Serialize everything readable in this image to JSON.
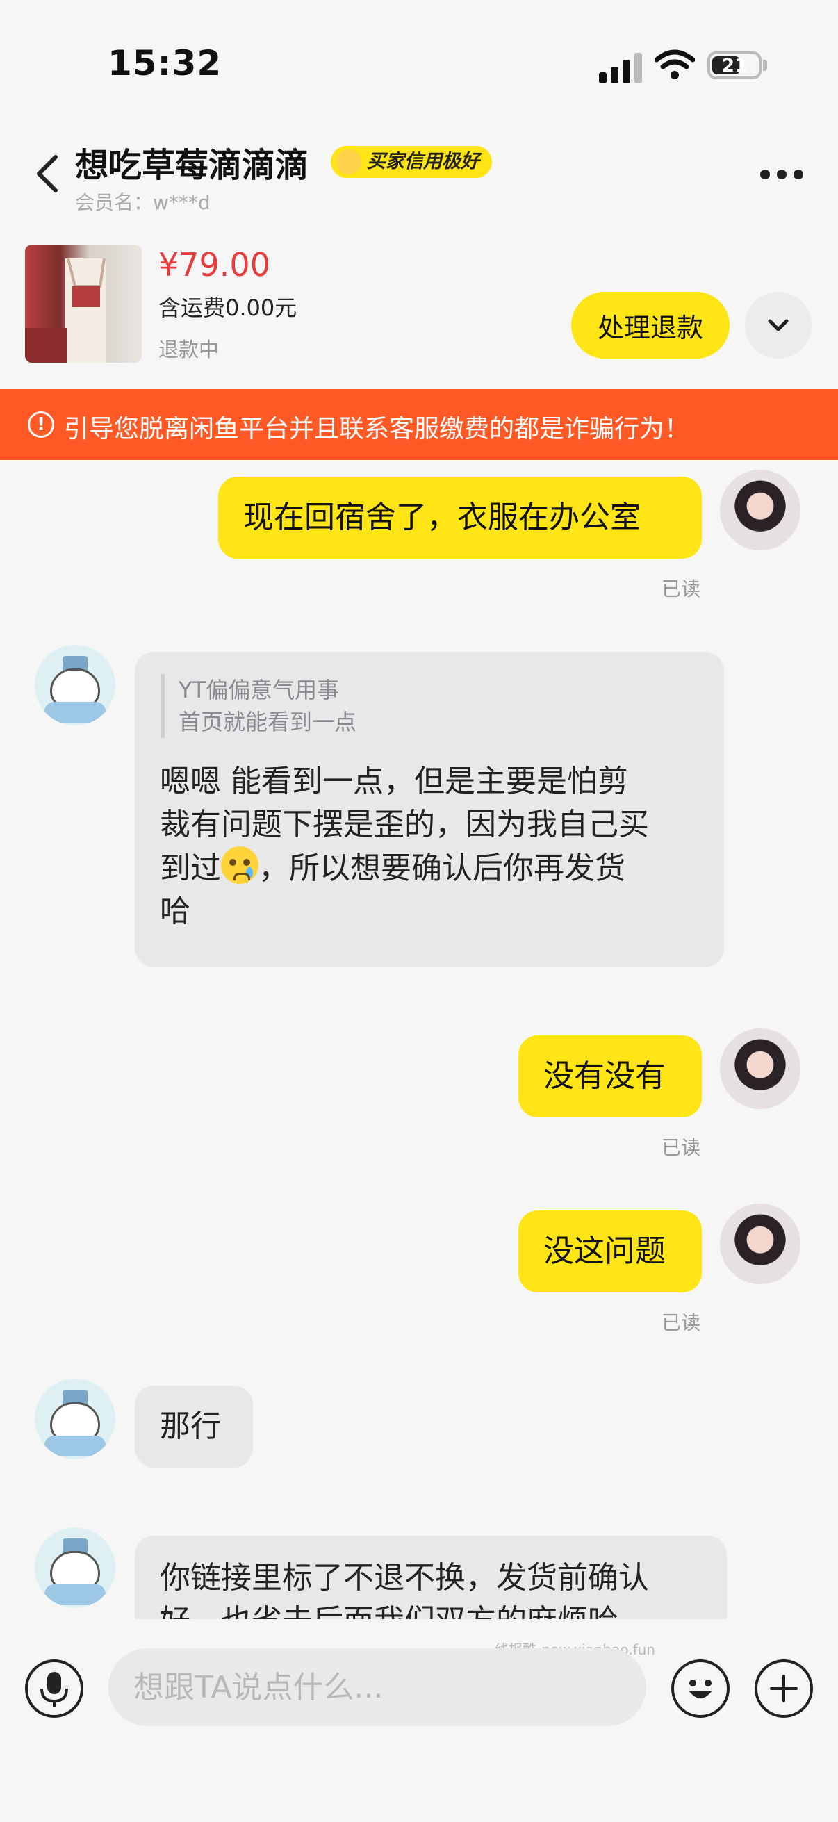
{
  "status_bar": {
    "time": "15:32",
    "battery": "21"
  },
  "header": {
    "title": "想吃草莓滴滴滴",
    "badge": "买家信用极好",
    "member_label": "会员名：w***d",
    "more_icon": "more-icon"
  },
  "product": {
    "price": "¥79.00",
    "shipping": "含运费0.00元",
    "status": "退款中",
    "refund_button": "处理退款"
  },
  "warning": "引导您脱离闲鱼平台并且联系客服缴费的都是诈骗行为！",
  "messages": {
    "m1": {
      "text": "现在回宿舍了，衣服在办公室",
      "read": "已读"
    },
    "m2": {
      "quote_name": "YT偏偏意气用事",
      "quote_text": "首页就能看到一点",
      "line1": "嗯嗯  能看到一点，但是主要是怕剪",
      "line2": "裁有问题下摆是歪的，因为我自己买",
      "line3a": "到过",
      "line3b": "，所以想要确认后你再发货",
      "line4": "哈"
    },
    "m3": {
      "text": "没有没有",
      "read": "已读"
    },
    "m4": {
      "text": "没这问题",
      "read": "已读"
    },
    "m5": {
      "text": "那行"
    },
    "m6": {
      "line1": "你链接里标了不退不换，发货前确认",
      "line2": "好，也省去后面我们双方的麻烦哈"
    }
  },
  "input": {
    "placeholder": "想跟TA说点什么..."
  },
  "watermark": "线报酷-new.xianbao.fun",
  "colors": {
    "accent": "#ffe515",
    "warning": "#ff5a26",
    "price": "#e63b3b"
  }
}
